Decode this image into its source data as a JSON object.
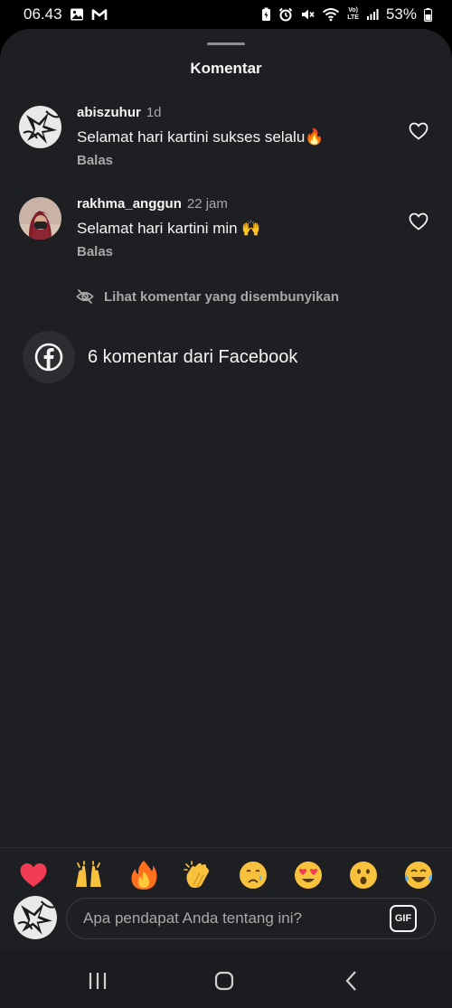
{
  "status_bar": {
    "time": "06.43",
    "battery_percent": "53%",
    "left_icons": [
      "image-icon",
      "gmail-icon"
    ],
    "right_icons": [
      "battery-saver-icon",
      "alarm-icon",
      "mute-icon",
      "wifi-icon",
      "volte-icon",
      "signal-icon",
      "battery-icon"
    ],
    "volte_top": "Vo)",
    "volte_bottom": "LTE"
  },
  "sheet": {
    "title": "Komentar"
  },
  "comments": [
    {
      "username": "abiszuhur",
      "time": "1d",
      "text": "Selamat hari kartini sukses selalu🔥",
      "reply_label": "Balas",
      "liked": false
    },
    {
      "username": "rakhma_anggun",
      "time": "22 jam",
      "text": "Selamat hari kartini min 🙌",
      "reply_label": "Balas",
      "liked": false
    }
  ],
  "hidden_comments": {
    "label": "Lihat komentar yang disembunyikan",
    "icon": "eye-off-icon"
  },
  "facebook": {
    "label": "6 komentar dari Facebook",
    "icon": "facebook-icon"
  },
  "emoji_bar": [
    "❤️",
    "🙌",
    "🔥",
    "👏",
    "😢",
    "😍",
    "😮",
    "😂"
  ],
  "comment_input": {
    "placeholder": "Apa pendapat Anda tentang ini?",
    "value": "",
    "gif_label": "GIF"
  },
  "nav_bar": {
    "buttons": [
      "recents-icon",
      "home-icon",
      "back-icon"
    ]
  },
  "colors": {
    "sheet_bg": "#1e1f22",
    "text_primary": "#f5f5f5",
    "text_secondary": "#a8a8a8",
    "facebook_circle": "#2c2d31"
  }
}
